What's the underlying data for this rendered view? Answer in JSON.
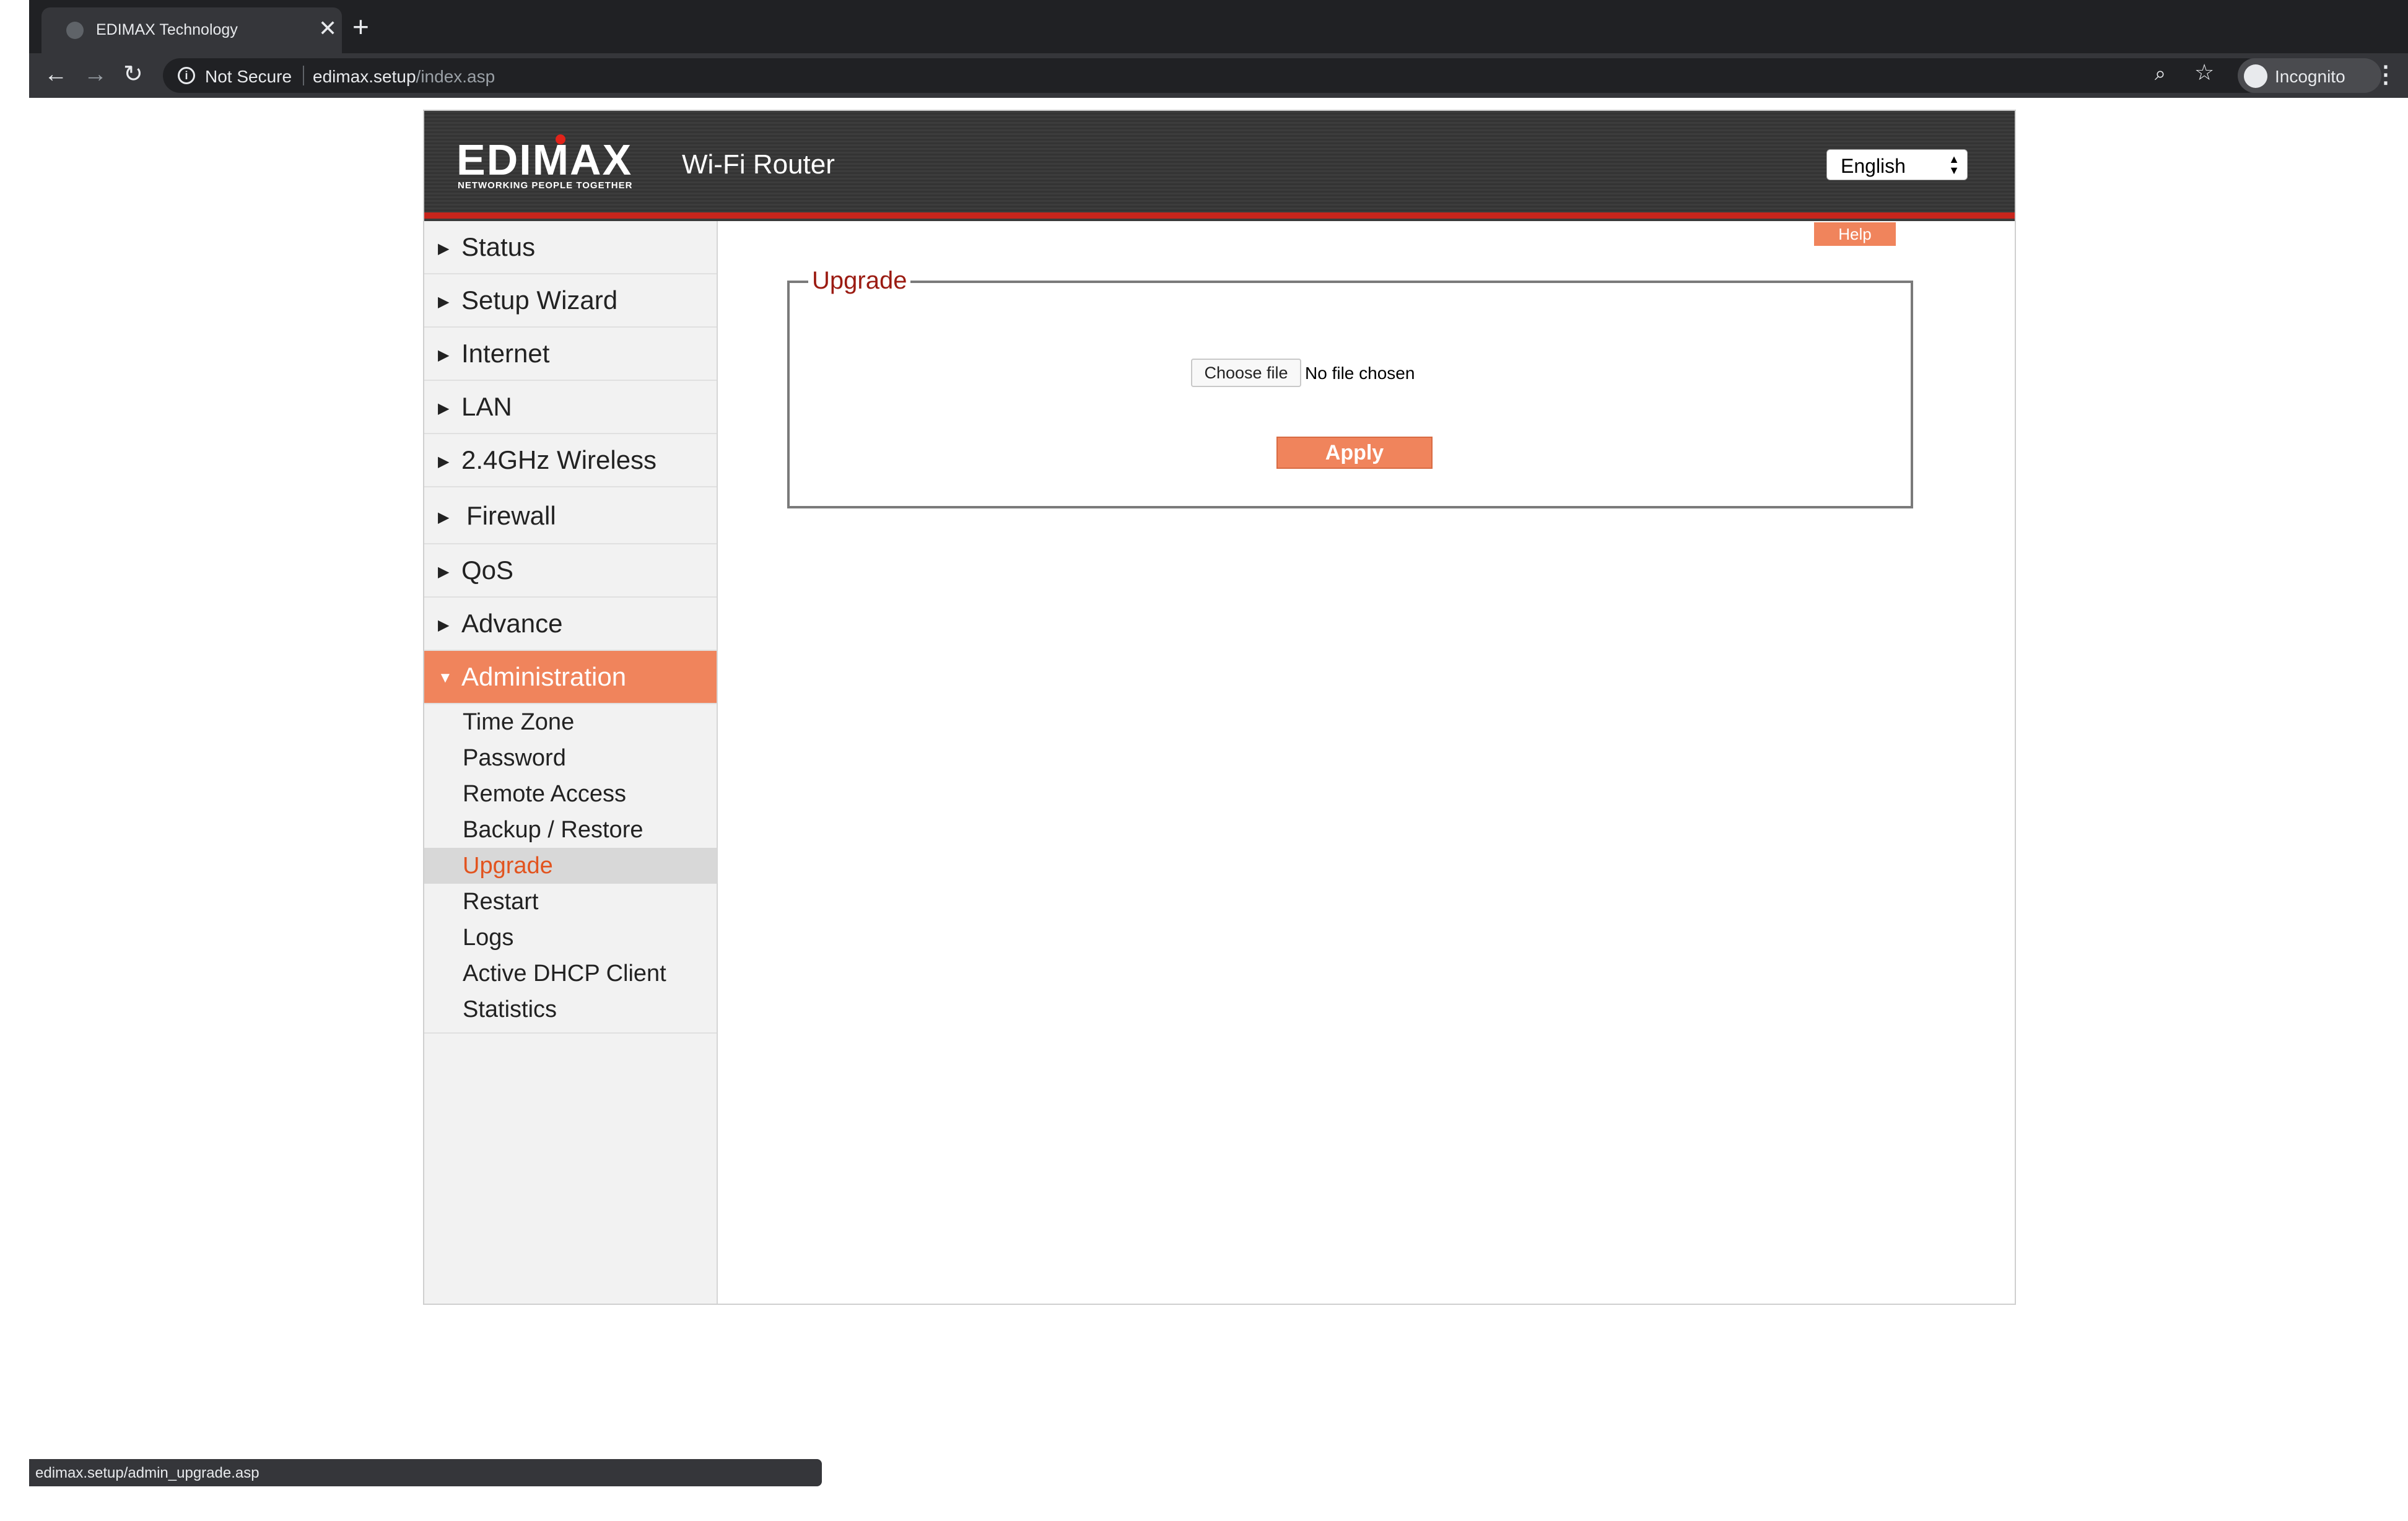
{
  "browser": {
    "tab_title": "EDIMAX Technology",
    "tab_close": "✕",
    "new_tab": "+",
    "security_label": "Not Secure",
    "url_host": "edimax.setup",
    "url_path": "/index.asp",
    "profile_label": "Incognito",
    "status_url": "edimax.setup/admin_upgrade.asp"
  },
  "header": {
    "logo_text": "EDIMAX",
    "logo_tagline": "NETWORKING PEOPLE TOGETHER",
    "product_title": "Wi-Fi Router",
    "language": "English"
  },
  "sidebar": {
    "items": [
      {
        "label": "Status",
        "active": false
      },
      {
        "label": "Setup Wizard",
        "active": false
      },
      {
        "label": "Internet",
        "active": false
      },
      {
        "label": "LAN",
        "active": false
      },
      {
        "label": "2.4GHz Wireless",
        "active": false
      },
      {
        "label": "Firewall",
        "active": false
      },
      {
        "label": "QoS",
        "active": false
      },
      {
        "label": "Advance",
        "active": false
      },
      {
        "label": "Administration",
        "active": true
      }
    ],
    "sub_items": [
      {
        "label": "Time Zone",
        "selected": false
      },
      {
        "label": "Password",
        "selected": false
      },
      {
        "label": "Remote Access",
        "selected": false
      },
      {
        "label": "Backup / Restore",
        "selected": false
      },
      {
        "label": "Upgrade",
        "selected": true
      },
      {
        "label": "Restart",
        "selected": false
      },
      {
        "label": "Logs",
        "selected": false
      },
      {
        "label": "Active DHCP Client",
        "selected": false
      },
      {
        "label": "Statistics",
        "selected": false
      }
    ]
  },
  "content": {
    "help_label": "Help",
    "section_title": "Upgrade",
    "choose_file_label": "Choose file",
    "file_status": "No file chosen",
    "apply_label": "Apply"
  },
  "colors": {
    "accent": "#f0845c",
    "header_red": "#c8251c",
    "legend_red": "#9b1b12",
    "selected_text": "#e2541f"
  }
}
